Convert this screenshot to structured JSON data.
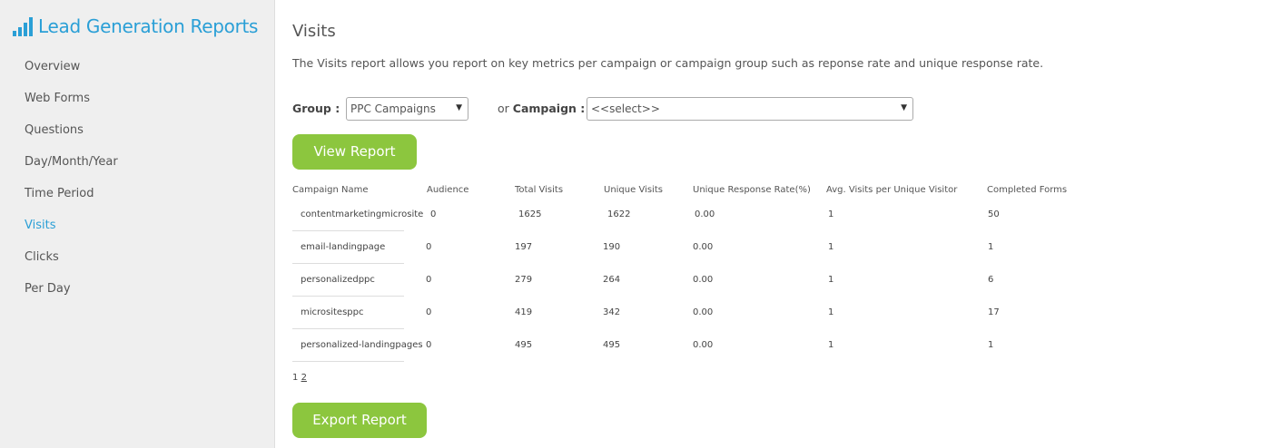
{
  "sidebar": {
    "title": "Lead Generation Reports",
    "items": [
      {
        "label": "Overview"
      },
      {
        "label": "Web Forms"
      },
      {
        "label": "Questions"
      },
      {
        "label": "Day/Month/Year"
      },
      {
        "label": "Time Period"
      },
      {
        "label": "Visits",
        "active": true
      },
      {
        "label": "Clicks"
      },
      {
        "label": "Per Day"
      }
    ]
  },
  "main": {
    "title": "Visits",
    "description": "The Visits report allows you report on key metrics per campaign or campaign group such as reponse rate and unique response rate.",
    "filters": {
      "group_label": "Group :",
      "group_value": "PPC Campaigns",
      "or_text": "or",
      "campaign_label": "Campaign :",
      "campaign_value": "<<select>>"
    },
    "view_button": "View Report",
    "export_button": "Export Report",
    "table": {
      "headers": [
        "Campaign Name",
        "Audience",
        "Total Visits",
        "Unique Visits",
        "Unique Response Rate(%)",
        "Avg. Visits per Unique Visitor",
        "Completed Forms"
      ],
      "rows": [
        [
          "contentmarketingmicrosite",
          "0",
          "1625",
          "1622",
          "0.00",
          "1",
          "50"
        ],
        [
          "email-landingpage",
          "0",
          "197",
          "190",
          "0.00",
          "1",
          "1"
        ],
        [
          "personalizedppc",
          "0",
          "279",
          "264",
          "0.00",
          "1",
          "6"
        ],
        [
          "micrositesppc",
          "0",
          "419",
          "342",
          "0.00",
          "1",
          "17"
        ],
        [
          "personalized-landingpages",
          "0",
          "495",
          "495",
          "0.00",
          "1",
          "1"
        ]
      ]
    },
    "pagination": {
      "current": "1",
      "pages": [
        "2"
      ]
    }
  },
  "colors": {
    "accent": "#2a9fd6",
    "button": "#8cc63e",
    "sidebar_bg": "#efefef"
  },
  "icons": {
    "brand": "bar-chart-icon",
    "dropdown": "caret-down-icon"
  }
}
